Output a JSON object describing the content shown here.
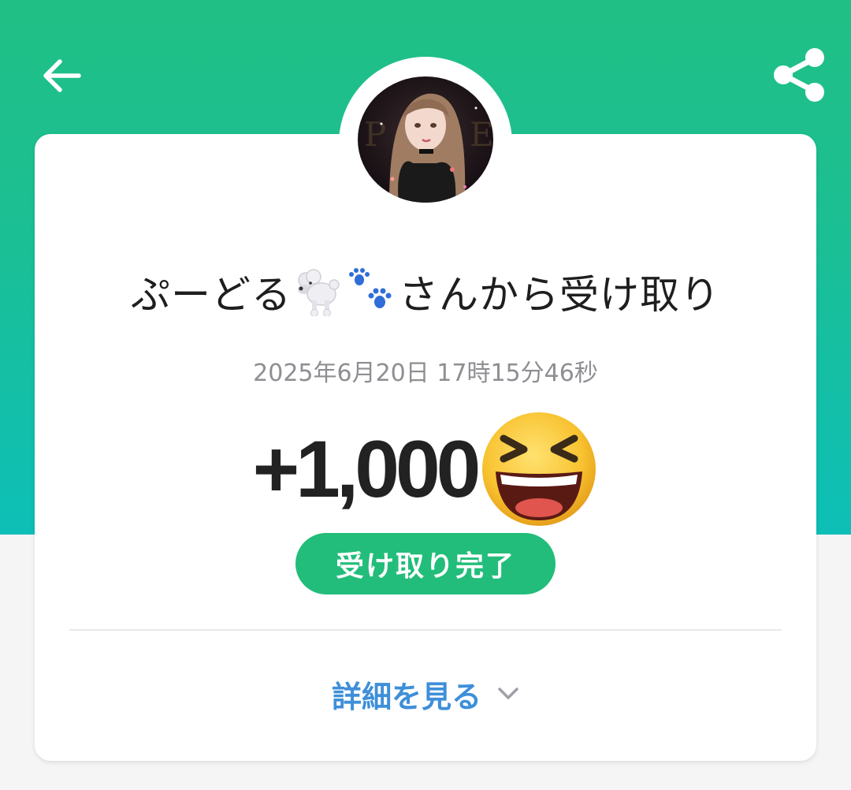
{
  "header": {
    "back_icon": "arrow-left-icon",
    "share_icon": "share-icon",
    "bg_top": "#20bf85",
    "bg_bottom": "#0dbfb7"
  },
  "sender": {
    "name_prefix": "ぷーどる",
    "name_emojis": [
      "poodle-emoji",
      "paw-prints-emoji"
    ],
    "title_suffix": "さんから受け取り",
    "avatar": "user-avatar"
  },
  "transaction": {
    "datetime": "2025年6月20日 17時15分46秒",
    "amount": "+1,000",
    "amount_emoji": "laughing-squint-face-emoji",
    "status": "受け取り完了",
    "status_color": "#22bd7a"
  },
  "details": {
    "label": "詳細を見る",
    "icon": "chevron-down-icon",
    "color": "#3e8fd9"
  }
}
